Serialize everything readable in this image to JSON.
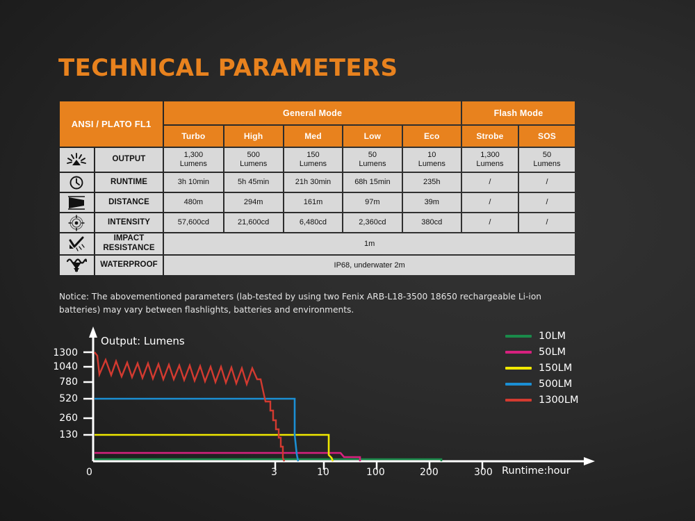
{
  "title": "TECHNICAL PARAMETERS",
  "accent_color": "#e8821e",
  "table": {
    "corner_header": "ANSI / PLATO FL1",
    "group_headers": [
      {
        "label": "General Mode",
        "span": 5
      },
      {
        "label": "Flash Mode",
        "span": 2
      }
    ],
    "mode_headers": [
      "Turbo",
      "High",
      "Med",
      "Low",
      "Eco",
      "Strobe",
      "SOS"
    ],
    "rows": [
      {
        "icon": "sunburst-icon",
        "label": "OUTPUT",
        "values": [
          "1,300\nLumens",
          "500\nLumens",
          "150\nLumens",
          "50\nLumens",
          "10\nLumens",
          "1,300\nLumens",
          "50\nLumens"
        ]
      },
      {
        "icon": "clock-icon",
        "label": "RUNTIME",
        "values": [
          "3h 10min",
          "5h 45min",
          "21h 30min",
          "68h 15min",
          "235h",
          "/",
          "/"
        ]
      },
      {
        "icon": "beam-wedge-icon",
        "label": "DISTANCE",
        "values": [
          "480m",
          "294m",
          "161m",
          "97m",
          "39m",
          "/",
          "/"
        ]
      },
      {
        "icon": "target-crosshair-icon",
        "label": "INTENSITY",
        "values": [
          "57,600cd",
          "21,600cd",
          "6,480cd",
          "2,360cd",
          "380cd",
          "/",
          "/"
        ]
      },
      {
        "icon": "impact-check-icon",
        "label": "IMPACT RESISTANCE",
        "merged_value": "1m"
      },
      {
        "icon": "water-drop-icon",
        "label": "WATERPROOF",
        "merged_value": "IP68, underwater 2m"
      }
    ]
  },
  "notice": "Notice: The abovementioned parameters (lab-tested by using two Fenix ARB-L18-3500 18650 rechargeable Li-ion batteries) may vary between flashlights, batteries and environments.",
  "chart_data": {
    "type": "line",
    "title": "",
    "ylabel": "Output: Lumens",
    "xlabel": "Runtime:hour",
    "yticks": [
      130,
      260,
      520,
      780,
      1040,
      1300
    ],
    "xticks": [
      0,
      3,
      10,
      100,
      200,
      300
    ],
    "grid": false,
    "legend_position": "right",
    "series": [
      {
        "name": "10LM",
        "color": "#1a8a4a",
        "level": 10,
        "runtime_h": 235,
        "points": [
          [
            0,
            10
          ],
          [
            200,
            10
          ],
          [
            235,
            10
          ],
          [
            235,
            0
          ]
        ]
      },
      {
        "name": "50LM",
        "color": "#d6217e",
        "level": 50,
        "runtime_h": 68.25,
        "points": [
          [
            0,
            50
          ],
          [
            40,
            50
          ],
          [
            55,
            35
          ],
          [
            68,
            35
          ],
          [
            68,
            0
          ]
        ]
      },
      {
        "name": "150LM",
        "color": "#f0e800",
        "level": 150,
        "runtime_h": 21.5,
        "points": [
          [
            0,
            150
          ],
          [
            16,
            150
          ],
          [
            21.5,
            150
          ],
          [
            21.5,
            20
          ],
          [
            23,
            0
          ]
        ]
      },
      {
        "name": "500LM",
        "color": "#1b8fd4",
        "level": 500,
        "runtime_h": 5.75,
        "points": [
          [
            0,
            500
          ],
          [
            5.5,
            500
          ],
          [
            5.75,
            150
          ],
          [
            5.8,
            40
          ],
          [
            6,
            0
          ]
        ]
      },
      {
        "name": "1300LM",
        "color": "#d33a30",
        "level": 1300,
        "runtime_h": 3.167,
        "points": [
          [
            0,
            1300
          ],
          [
            0.2,
            1000
          ],
          [
            2.6,
            950
          ],
          [
            2.9,
            620
          ],
          [
            3.0,
            350
          ],
          [
            3.1,
            150
          ],
          [
            3.17,
            40
          ],
          [
            3.2,
            0
          ]
        ],
        "note": "oscillating sawtooth between ~1040 and ~850 lumens for first ~2.6h, then stepped decay"
      }
    ]
  },
  "legend": [
    {
      "label": "10LM",
      "color": "#1a8a4a"
    },
    {
      "label": "50LM",
      "color": "#d6217e"
    },
    {
      "label": "150LM",
      "color": "#f0e800"
    },
    {
      "label": "500LM",
      "color": "#1b8fd4"
    },
    {
      "label": "1300LM",
      "color": "#d33a30"
    }
  ]
}
